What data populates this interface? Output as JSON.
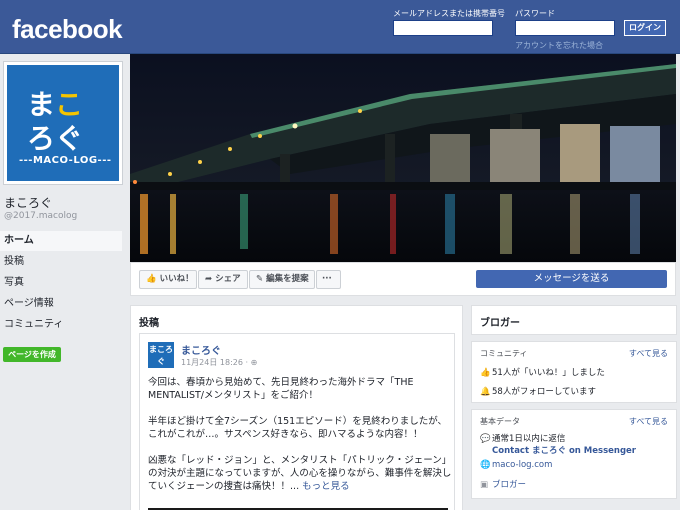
{
  "header": {
    "logo": "facebook",
    "email_label": "メールアドレスまたは携帯番号",
    "password_label": "パスワード",
    "login_button": "ログイン",
    "forgot_link": "アカウントを忘れた場合"
  },
  "profile": {
    "pic_line1_a": "ま",
    "pic_line1_b": "こ",
    "pic_line2": "ろぐ",
    "pic_tag": "---MACO-LOG---",
    "name": "まころぐ",
    "handle": "@2017.macolog"
  },
  "nav": {
    "items": [
      "ホーム",
      "投稿",
      "写真",
      "ページ情報",
      "コミュニティ"
    ],
    "create_page": "ページを作成"
  },
  "actions": {
    "like": "いいね！",
    "share": "シェア",
    "suggest": "編集を提案",
    "more": "···",
    "message": "メッセージを送る"
  },
  "posts": {
    "heading": "投稿",
    "author": "まころぐ",
    "avatar_text": "まころぐ",
    "time": "11月24日 18:26 · ⊕",
    "p1": "今回は、春頃から見始めて、先日見終わった海外ドラマ「THE MENTALIST/メンタリスト」をご紹介！",
    "p2": "半年ほど掛けて全7シーズン（151エピソード）を見終わりましたが、これがこれが…。サスペンス好きなら、即ハマるような内容！！",
    "p3": "凶悪な「レッド・ジョン」と、メンタリスト「パトリック・ジェーン」の対決が主題になっていますが、人の心を操りながら、難事件を解決していくジェーンの捜査は痛快！！...",
    "see_more": "もっと見る"
  },
  "sidebar": {
    "blogger_title": "ブロガー",
    "community_title": "コミュニティ",
    "see_all": "すべて見る",
    "likes": "51人が「いいね！」しました",
    "follows": "58人がフォローしています",
    "basic_title": "基本データ",
    "reply_note": "通常1日以内に返信",
    "contact": "Contact まころぐ on Messenger",
    "website": "maco-log.com",
    "category": "ブロガー"
  }
}
